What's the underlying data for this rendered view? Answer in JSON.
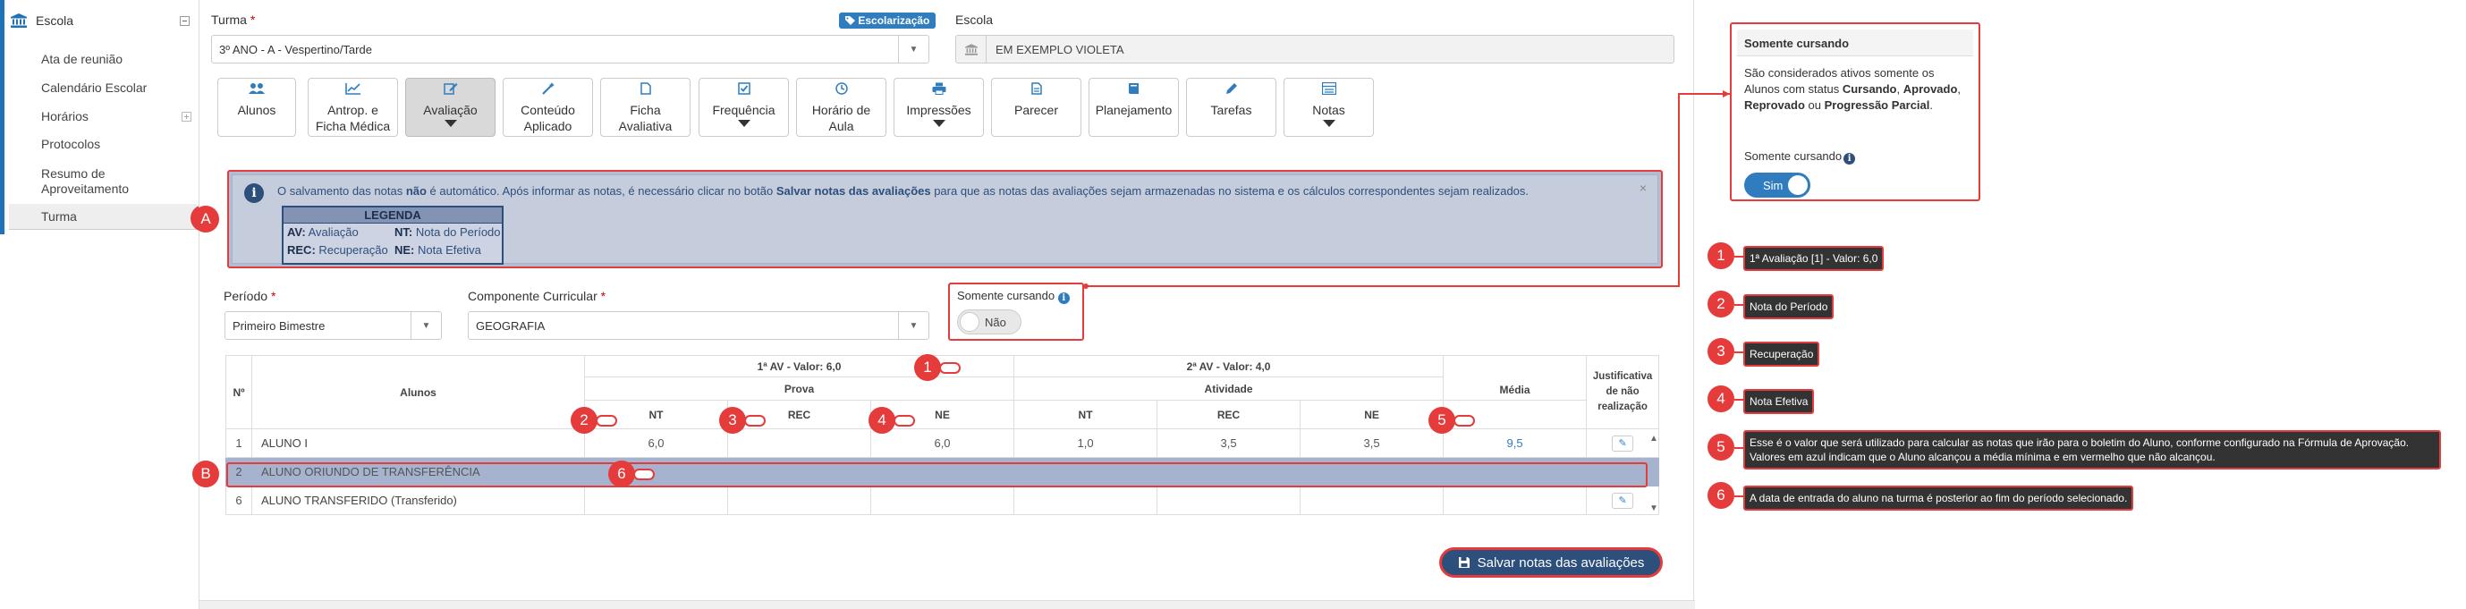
{
  "sidebar": {
    "title": "Escola",
    "items": [
      {
        "label": "Ata de reunião"
      },
      {
        "label": "Calendário Escolar"
      },
      {
        "label": "Horários"
      },
      {
        "label": "Protocolos"
      },
      {
        "label": "Resumo de Aproveitamento",
        "line1": "Resumo de",
        "line2": "Aproveitamento"
      },
      {
        "label": "Turma"
      }
    ]
  },
  "form": {
    "turma_label": "Turma",
    "turma_value": "3º ANO - A - Vespertino/Tarde",
    "escolarizacao_badge": "Escolarização",
    "escola_label": "Escola",
    "escola_value": "EM EXEMPLO VIOLETA",
    "required_mark": "*"
  },
  "toolbar": [
    {
      "line1": "Alunos",
      "line2": ""
    },
    {
      "line1": "Antrop. e",
      "line2": "Ficha Médica"
    },
    {
      "line1": "Avaliação",
      "line2": ""
    },
    {
      "line1": "Conteúdo",
      "line2": "Aplicado"
    },
    {
      "line1": "Ficha",
      "line2": "Avaliativa"
    },
    {
      "line1": "Frequência",
      "line2": ""
    },
    {
      "line1": "Horário de",
      "line2": "Aula"
    },
    {
      "line1": "Impressões",
      "line2": ""
    },
    {
      "line1": "Parecer",
      "line2": ""
    },
    {
      "line1": "Planejamento",
      "line2": ""
    },
    {
      "line1": "Tarefas",
      "line2": ""
    },
    {
      "line1": "Notas",
      "line2": ""
    }
  ],
  "info": {
    "text_pre": "O salvamento das notas ",
    "text_bold1": "não",
    "text_mid": " é automático. Após informar as notas, é necessário clicar no botão ",
    "text_bold2": "Salvar notas das avaliações",
    "text_post": " para que as notas das avaliações sejam armazenadas no sistema e os cálculos correspondentes sejam realizados.",
    "close": "×",
    "legend_title": "LEGENDA",
    "legend": [
      {
        "k1": "AV:",
        "v1": "Avaliação",
        "k2": "NT:",
        "v2": "Nota do Período"
      },
      {
        "k1": "REC:",
        "v1": "Recuperação",
        "k2": "NE:",
        "v2": "Nota Efetiva"
      }
    ]
  },
  "filters": {
    "periodo_label": "Período",
    "periodo_value": "Primeiro Bimestre",
    "componente_label": "Componente Curricular",
    "componente_value": "GEOGRAFIA",
    "somente_label": "Somente cursando",
    "somente_value": "Não"
  },
  "grid": {
    "col_num": "Nº",
    "col_alunos": "Alunos",
    "av1": "1ª AV - Valor: 6,0",
    "av1_sub": "Prova",
    "av2": "2ª AV - Valor: 4,0",
    "av2_sub": "Atividade",
    "col_media": "Média",
    "col_just": "Justificativa de não realização",
    "sub_nt": "NT",
    "sub_rec": "REC",
    "sub_ne": "NE",
    "rows": [
      {
        "num": "1",
        "name": "ALUNO I",
        "nt1": "6,0",
        "rec1": "",
        "ne1": "6,0",
        "nt2": "1,0",
        "rec2": "3,5",
        "ne2": "3,5",
        "media": "9,5"
      },
      {
        "num": "2",
        "name": "ALUNO ORIUNDO DE TRANSFERÊNCIA",
        "nt1": "",
        "rec1": "",
        "ne1": "",
        "nt2": "",
        "rec2": "",
        "ne2": "",
        "media": ""
      },
      {
        "num": "6",
        "name": "ALUNO TRANSFERIDO (Transferido)",
        "nt1": "",
        "rec1": "",
        "ne1": "",
        "nt2": "",
        "rec2": "",
        "ne2": "",
        "media": ""
      }
    ]
  },
  "save_label": "Salvar notas das avaliações",
  "popover": {
    "title": "Somente cursando",
    "b_pre": "São considerados ativos somente os Alunos com status ",
    "b_cursando": "Cursando",
    "b_sep1": ", ",
    "b_aprovado": "Aprovado",
    "b_sep2": ", ",
    "b_reprovado": "Reprovado",
    "b_ou": " ou ",
    "b_progressao": "Progressão Parcial",
    "b_end": ".",
    "field_label": "Somente cursando",
    "toggle_value": "Sim"
  },
  "markers": [
    "A",
    "B",
    "1",
    "2",
    "3",
    "4",
    "5",
    "6"
  ],
  "notes": [
    {
      "n": "1",
      "text": "1ª Avaliação [1] - Valor: 6,0"
    },
    {
      "n": "2",
      "text": "Nota do Período"
    },
    {
      "n": "3",
      "text": "Recuperação"
    },
    {
      "n": "4",
      "text": "Nota Efetiva"
    },
    {
      "n": "5",
      "text": "Esse é o valor que será utilizado para calcular as notas que irão para o boletim do Aluno, conforme configurado na Fórmula de Aprovação. Valores em azul indicam que o Aluno alcançou a média mínima e em vermelho que não alcançou."
    },
    {
      "n": "6",
      "text": "A data de entrada do aluno na turma é posterior ao fim do período selecionado."
    }
  ],
  "icons": {
    "sidebar": "bank-icon",
    "escola": "bank-icon",
    "info": "info-icon",
    "save": "floppy-icon"
  }
}
